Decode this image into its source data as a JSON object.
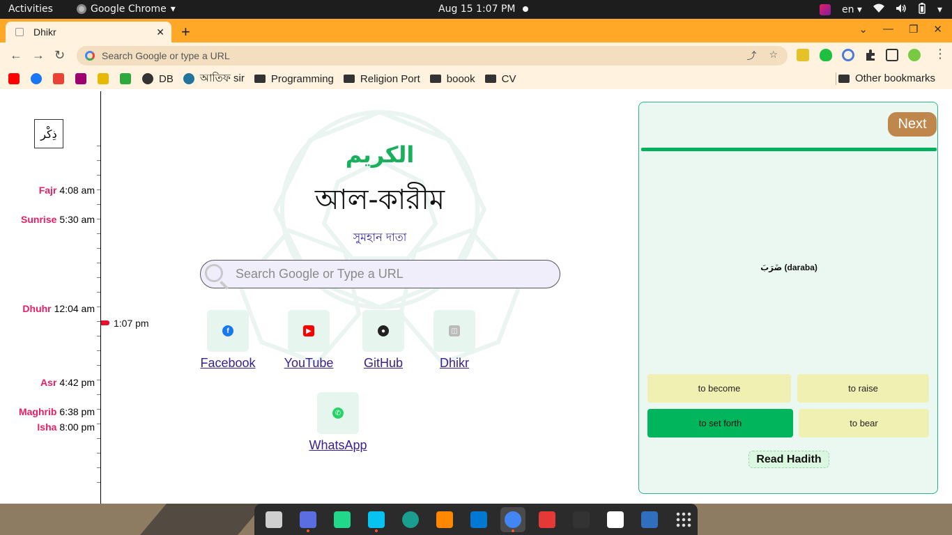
{
  "system": {
    "activities": "Activities",
    "app_name": "Google Chrome",
    "clock": "Aug 15  1:07 PM",
    "language": "en"
  },
  "browser": {
    "tab_title": "Dhikr",
    "omnibox_placeholder": "Search Google or type a URL",
    "bookmarks": [
      {
        "label": "",
        "icon": "youtube-icon",
        "color": "#ff0000"
      },
      {
        "label": "",
        "icon": "facebook-icon",
        "color": "#1877f2"
      },
      {
        "label": "",
        "icon": "gmail-icon",
        "color": "#ea4335"
      },
      {
        "label": "",
        "icon": "uva-icon",
        "color": "#a0006e"
      },
      {
        "label": "",
        "icon": "medal-icon",
        "color": "#e6b800"
      },
      {
        "label": "",
        "icon": "leaf-icon",
        "color": "#2eaa3c"
      },
      {
        "label": "DB",
        "icon": "globe-icon",
        "color": "#333333"
      },
      {
        "label": "আতিফ sir",
        "icon": "wordpress-icon",
        "color": "#21759b"
      },
      {
        "label": "Programming",
        "icon": "folder-icon",
        "color": "#333333"
      },
      {
        "label": "Religion Port",
        "icon": "folder-icon",
        "color": "#333333"
      },
      {
        "label": "boook",
        "icon": "folder-icon",
        "color": "#333333"
      },
      {
        "label": "CV",
        "icon": "folder-icon",
        "color": "#333333"
      }
    ],
    "other_bookmarks": "Other bookmarks"
  },
  "timeline": {
    "logo_text": "ذِكْر",
    "prayers": [
      {
        "name": "Fajr",
        "time": "4:08 am"
      },
      {
        "name": "Sunrise",
        "time": "5:30 am"
      },
      {
        "name": "Dhuhr",
        "time": "12:04 am"
      },
      {
        "name": "Asr",
        "time": "4:42 pm"
      },
      {
        "name": "Maghrib",
        "time": "6:38 pm"
      },
      {
        "name": "Isha",
        "time": "8:00 pm"
      }
    ],
    "current_time": "1:07 pm"
  },
  "main": {
    "arabic_name": "الكريم",
    "bangla_name": "আল-কারীম",
    "meaning": "সুমহান দাতা",
    "search_placeholder": "Search Google or Type a URL",
    "shortcuts": [
      {
        "label": "Facebook",
        "icon": "facebook-icon",
        "color": "#1877f2"
      },
      {
        "label": "YouTube",
        "icon": "youtube-icon",
        "color": "#ff0000"
      },
      {
        "label": "GitHub",
        "icon": "github-icon",
        "color": "#222222"
      },
      {
        "label": "Dhikr",
        "icon": "dhikr-icon",
        "color": "#bbbbbb"
      },
      {
        "label": "WhatsApp",
        "icon": "whatsapp-icon",
        "color": "#25d366"
      }
    ]
  },
  "quiz": {
    "next_label": "Next",
    "progress": 1.0,
    "word": "ضَرَبَ (daraba)",
    "options": [
      {
        "label": "to become",
        "correct": false
      },
      {
        "label": "to raise",
        "correct": false
      },
      {
        "label": "to set forth",
        "correct": true
      },
      {
        "label": "to bear",
        "correct": false
      }
    ],
    "hadith_label": "Read Hadith"
  },
  "dock": {
    "apps": [
      "files-icon",
      "screenshot-icon",
      "clion-icon",
      "webstorm-icon",
      "gitkraken-icon",
      "vlc-icon",
      "vscode-icon",
      "chrome-icon",
      "libreoffice-icon",
      "terminal-icon",
      "notion-icon",
      "virtualbox-icon",
      "app-grid-icon"
    ],
    "colors": [
      "#cfcfcf",
      "#5b6ee1",
      "#21d789",
      "#07c3f2",
      "#1a9e8f",
      "#ff8800",
      "#0078d4",
      "#4285f4",
      "#e53935",
      "#333333",
      "#ffffff",
      "#2f6fbd",
      "#dddddd"
    ]
  }
}
